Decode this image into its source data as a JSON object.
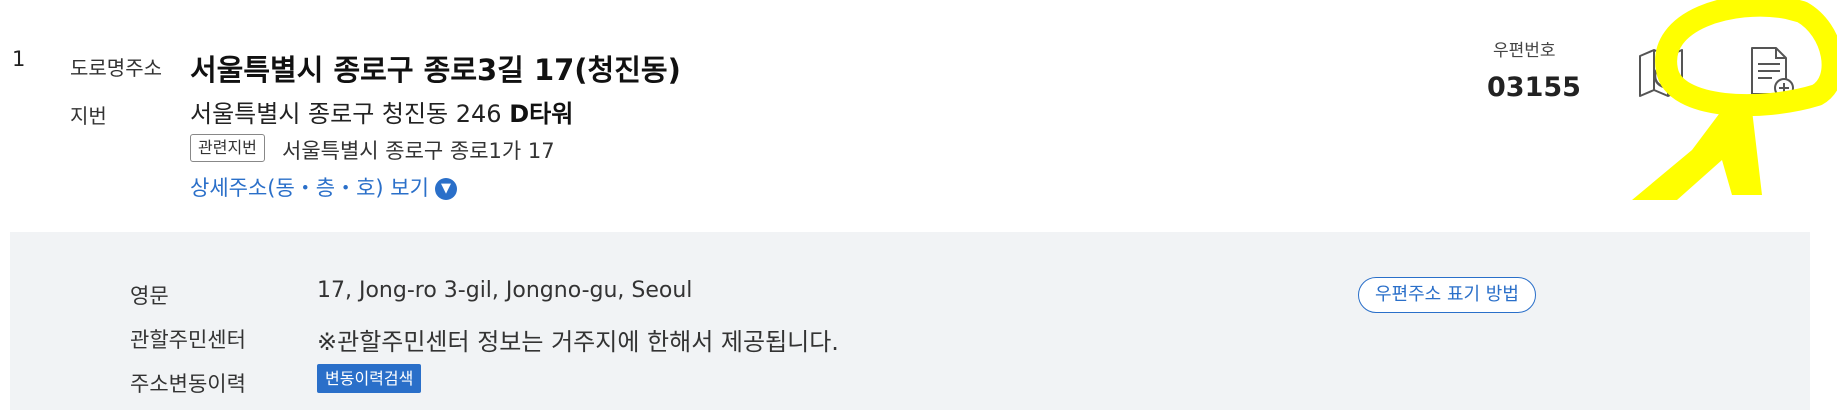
{
  "result": {
    "number": "1",
    "road_label": "도로명주소",
    "road_address": "서울특별시 종로구 종로3길 17(청진동)",
    "jibun_label": "지번",
    "jibun_address": "서울특별시 종로구 청진동 246",
    "building_name": "D타워",
    "related_badge": "관련지번",
    "related_address": "서울특별시 종로구 종로1가 17",
    "detail_link": "상세주소(동・층・호) 보기"
  },
  "postal": {
    "label": "우편번호",
    "code": "03155"
  },
  "actions": {
    "map_icon": "map-search-icon",
    "doc_icon": "document-add-icon"
  },
  "details": {
    "english_label": "영문",
    "english_value": "17, Jong-ro 3-gil, Jongno-gu, Seoul",
    "center_label": "관할주민센터",
    "center_value": "※관할주민센터 정보는 거주지에 한해서 제공됩니다.",
    "history_label": "주소변동이력",
    "history_button": "변동이력검색",
    "postal_guide_button": "우편주소 표기 방법"
  },
  "colors": {
    "accent": "#2a6fc9",
    "panel_bg": "#f1f3f5",
    "highlight": "#ffff00"
  }
}
